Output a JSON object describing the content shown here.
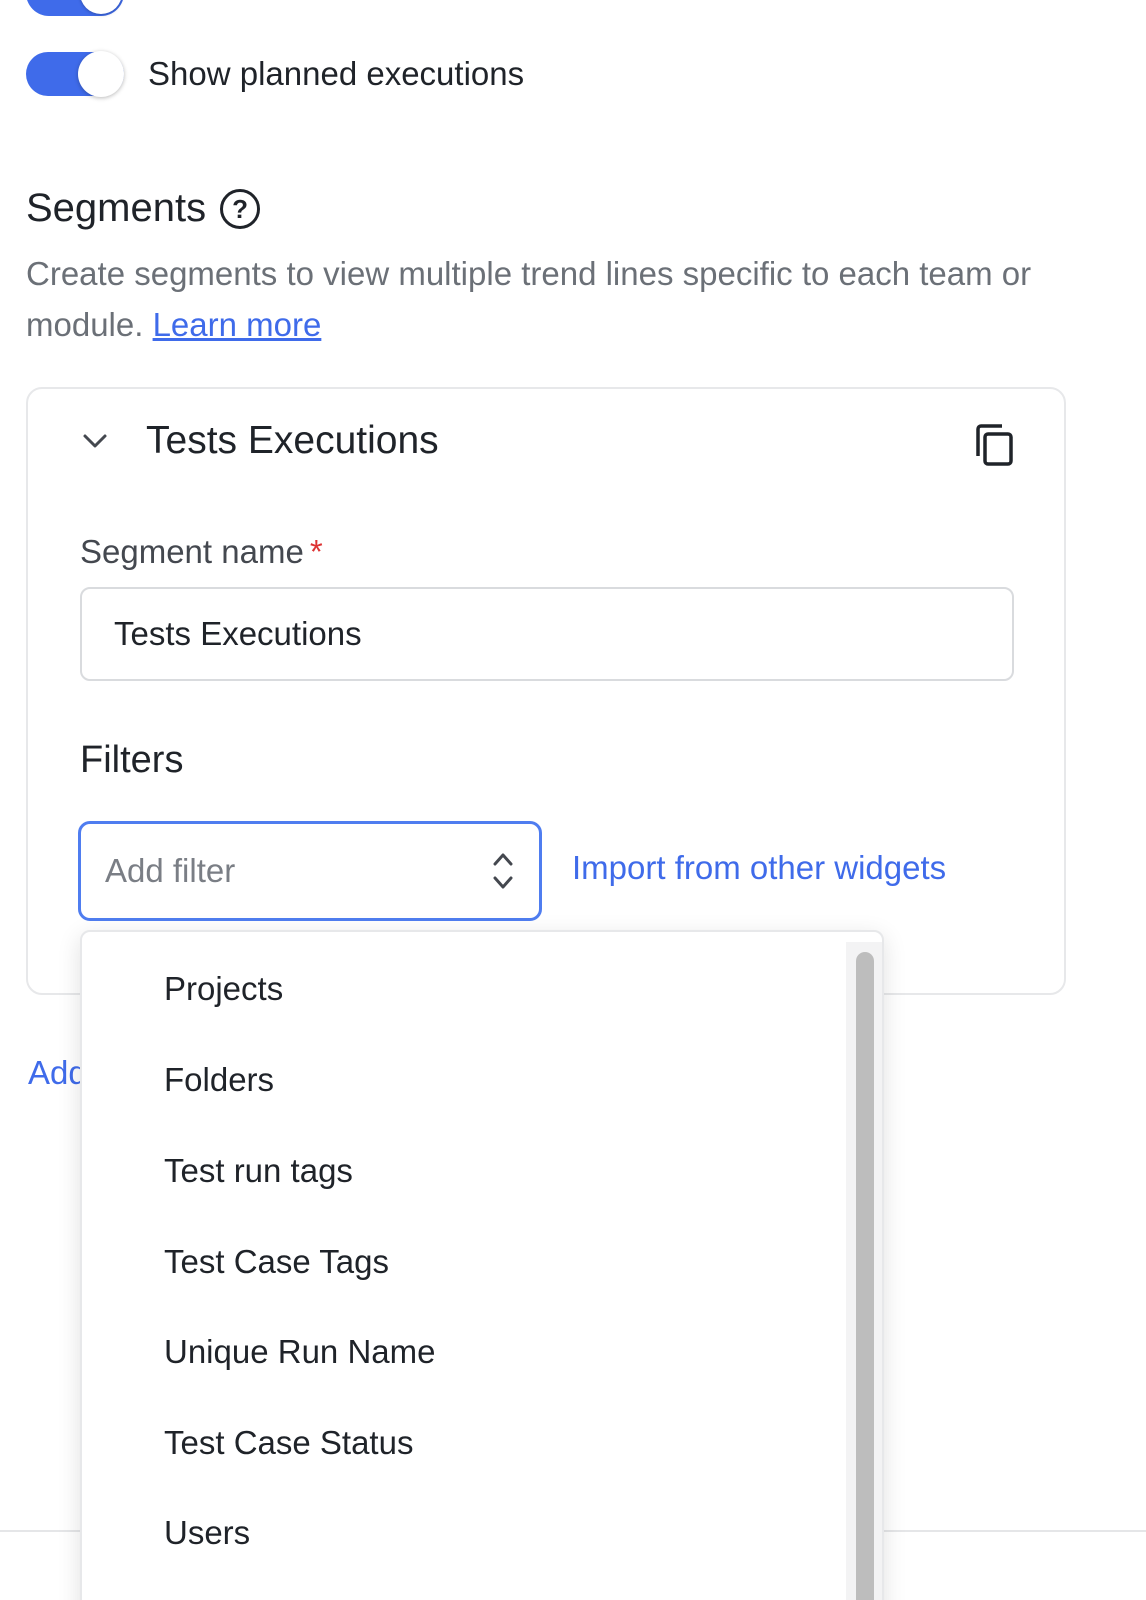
{
  "top_toggle": {
    "label": "",
    "on": true
  },
  "planned_toggle": {
    "label": "Show planned executions",
    "on": true
  },
  "segments": {
    "title": "Segments",
    "help_icon": "help-icon",
    "description": "Create segments to view multiple trend lines specific to each team or module.",
    "learn_more": "Learn more"
  },
  "segment_card": {
    "title": "Tests Executions",
    "chevron_icon": "chevron-down-icon",
    "copy_icon": "copy-icon",
    "name_label": "Segment name",
    "required_mark": "*",
    "name_value": "Tests Executions",
    "filters_title": "Filters",
    "filter_placeholder": "Add filter",
    "import_link": "Import from other widgets"
  },
  "add_link": "Add",
  "filter_options": [
    "Projects",
    "Folders",
    "Test run tags",
    "Test Case Tags",
    "Unique Run Name",
    "Test Case Status",
    "Users"
  ],
  "colors": {
    "accent": "#3f6bea",
    "focus_border": "#4f7df0",
    "required": "#dd3333"
  }
}
